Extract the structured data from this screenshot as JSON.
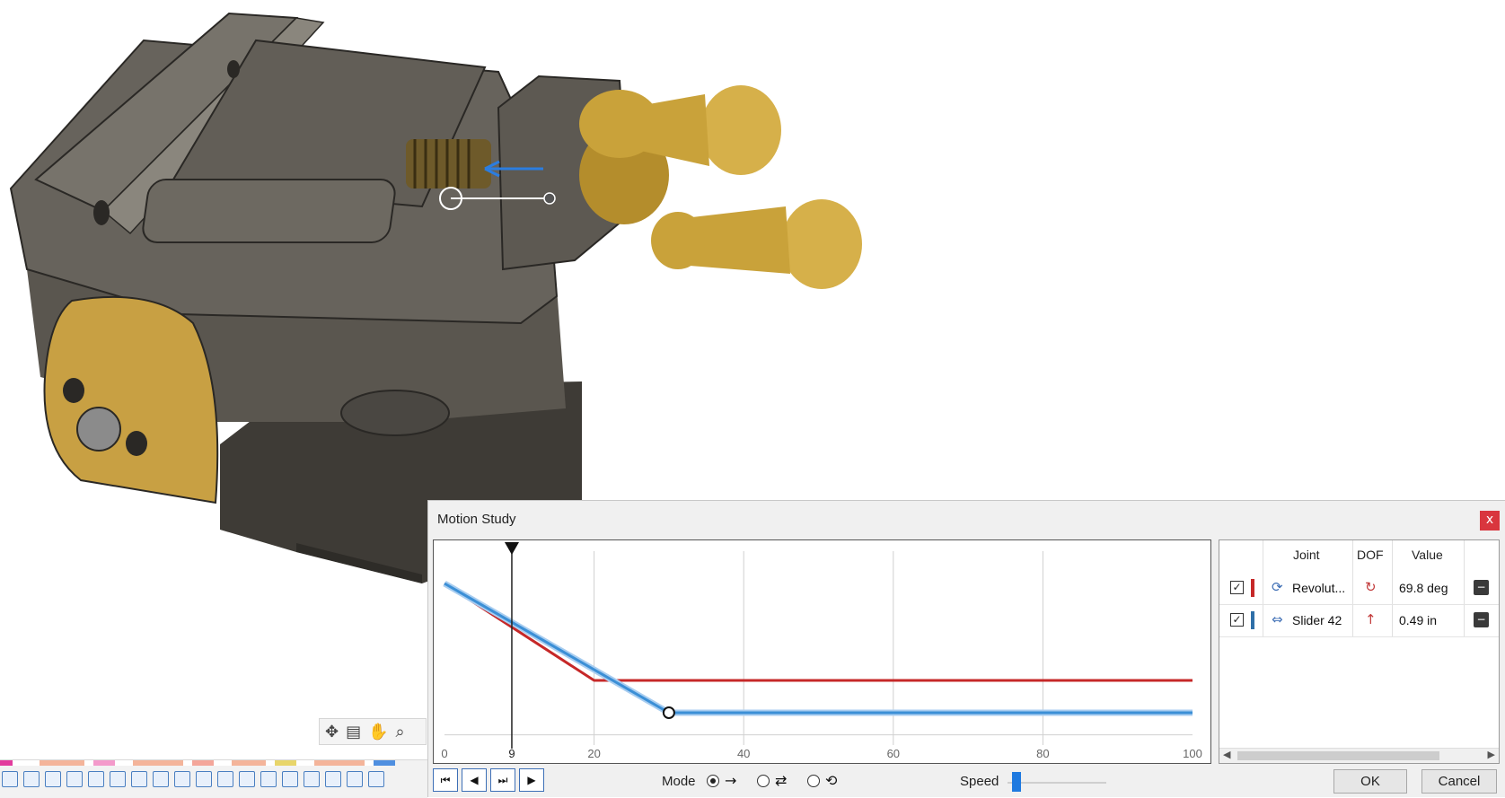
{
  "motion_study": {
    "title": "Motion Study",
    "close_label": "x",
    "graph": {
      "x_ticks": [
        "0",
        "20",
        "40",
        "60",
        "80",
        "100"
      ],
      "playhead_label": "9",
      "playhead_position": 9,
      "series": [
        {
          "joint": "Revolute",
          "color": "#c62828",
          "points": [
            [
              0,
              10
            ],
            [
              20,
              4
            ],
            [
              100,
              4
            ]
          ]
        },
        {
          "joint": "Slider 42",
          "color": "#3b8fd6",
          "points": [
            [
              0,
              10
            ],
            [
              30,
              2
            ],
            [
              100,
              2
            ]
          ]
        }
      ]
    },
    "joints_table": {
      "headers": {
        "joint": "Joint",
        "dof": "DOF",
        "value": "Value"
      },
      "rows": [
        {
          "checked": true,
          "color": "#c62828",
          "icon": "revolute-joint-icon",
          "name": "Revolut...",
          "dof_icon": "rotation-dof-icon",
          "value": "69.8 deg"
        },
        {
          "checked": true,
          "color": "#2f6fa8",
          "icon": "slider-joint-icon",
          "name": "Slider 42",
          "dof_icon": "linear-dof-icon",
          "value": "0.49 in"
        }
      ]
    },
    "playback": {
      "mode_label": "Mode",
      "modes": [
        {
          "icon": "play-once-icon",
          "glyph": "→",
          "selected": true
        },
        {
          "icon": "ping-pong-icon",
          "glyph": "⇄",
          "selected": false
        },
        {
          "icon": "loop-icon",
          "glyph": "⟲",
          "selected": false
        }
      ],
      "speed_label": "Speed",
      "speed_value": 0.05
    },
    "ok_label": "OK",
    "cancel_label": "Cancel"
  },
  "viewport": {
    "model": "machine-vise",
    "model_colors": {
      "body": "#5f5a52",
      "brass": "#c9a23a"
    }
  },
  "navigation_toolbar": {
    "icons": [
      "orbit-icon",
      "look-at-icon",
      "pan-icon",
      "zoom-icon"
    ]
  }
}
